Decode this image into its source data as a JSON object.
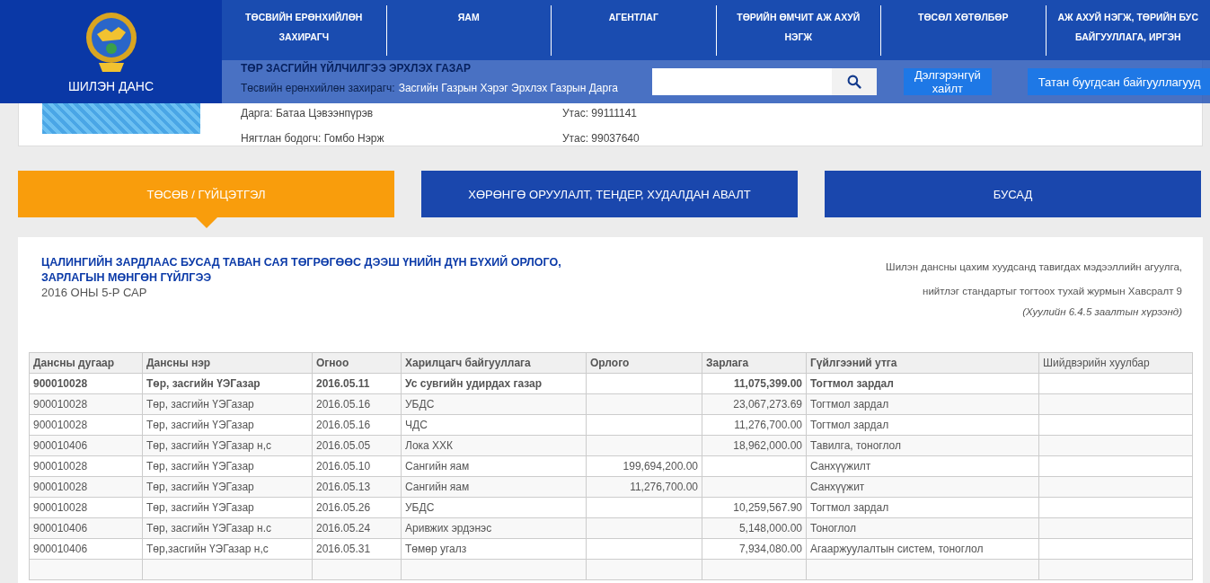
{
  "header": {
    "logo_text": "ШИЛЭН ДАНС",
    "nav": [
      {
        "label": "ТӨСВИЙН ЕРӨНХИЙЛӨН ЗАХИРАГЧ"
      },
      {
        "label": "ЯАМ"
      },
      {
        "label": "АГЕНТЛАГ"
      },
      {
        "label": "ТӨРИЙН ӨМЧИТ АЖ АХУЙ НЭГЖ"
      },
      {
        "label": "ТӨСӨЛ ХӨТӨЛБӨР"
      },
      {
        "label": "АЖ АХУЙ НЭГЖ, ТӨРИЙН БУС БАЙГУУЛЛАГА, ИРГЭН"
      }
    ],
    "buttons": [
      "Дэлгэрэнгүй хайлт",
      "Татан буугдсан байгууллагууд"
    ]
  },
  "org": {
    "title": "ТӨР ЗАСГИЙН ҮЙЛЧИЛГЭЭ ЭРХЛЭХ ГАЗАР",
    "manager_label": "Төсвийн ерөнхийлөн захирагч:",
    "manager_link": "Засгийн Газрын Хэрэг Эрхлэх Газрын Дарга",
    "contacts": [
      {
        "person": "Дарга: Батаа Цэвээнпүрэв",
        "phone": "Утас: 99111141"
      },
      {
        "person": "Нягтлан бодогч: Гомбо Нэрж",
        "phone": "Утас: 99037640"
      }
    ]
  },
  "tabs": [
    {
      "label": "ТӨСӨВ / ГҮЙЦЭТГЭЛ",
      "selected": true
    },
    {
      "label": "ХӨРӨНГӨ ОРУУЛАЛТ, ТЕНДЕР, ХУДАЛДАН АВАЛТ",
      "selected": false
    },
    {
      "label": "БУСАД",
      "selected": false
    }
  ],
  "report": {
    "title": "ЦАЛИНГИЙН ЗАРДЛААС БУСАД ТАВАН САЯ ТӨГРӨГӨӨС ДЭЭШ ҮНИЙН ДҮН БҮХИЙ ОРЛОГО, ЗАРЛАГЫН МӨНГӨН ГҮЙЛГЭЭ",
    "period": "2016 ОНЫ 5-Р САР",
    "notes": [
      "Шилэн дансны цахим хуудсанд тавигдах мэдээллийн агуулга,",
      "нийтлэг стандартыг тогтоох тухай журмын Хавсралт 9"
    ],
    "law_note": "(Хуулийн 6.4.5 заалтын хүрээнд)"
  },
  "table": {
    "columns": [
      "Дансны дугаар",
      "Дансны нэр",
      "Огноо",
      "Харилцагч байгууллага",
      "Орлого",
      "Зарлага",
      "Гүйлгээний утга",
      "Шийдвэрийн хуулбар"
    ],
    "rows": [
      {
        "bold": true,
        "cells": [
          "900010028",
          "Төр, засгийн ҮЭГазар",
          "2016.05.11",
          "Ус сувгийн удирдах газар",
          "",
          "11,075,399.00",
          "Тогтмол зардал",
          ""
        ]
      },
      {
        "bold": false,
        "cells": [
          "900010028",
          "Төр, засгийн ҮЭГазар",
          "2016.05.16",
          "УБДС",
          "",
          "23,067,273.69",
          "Тогтмол зардал",
          ""
        ]
      },
      {
        "bold": false,
        "cells": [
          "900010028",
          "Төр, засгийн ҮЭГазар",
          "2016.05.16",
          "ЧДС",
          "",
          "11,276,700.00",
          "Тогтмол зардал",
          ""
        ]
      },
      {
        "bold": false,
        "cells": [
          "900010406",
          "Төр, засгийн ҮЭГазар н,с",
          "2016.05.05",
          "Лока ХХК",
          "",
          "18,962,000.00",
          "Тавилга, тоноглол",
          ""
        ]
      },
      {
        "bold": false,
        "cells": [
          "900010028",
          "Төр, засгийн ҮЭГазар",
          "2016.05.10",
          "Сангийн яам",
          "199,694,200.00",
          "",
          "Санхүүжилт",
          ""
        ]
      },
      {
        "bold": false,
        "cells": [
          "900010028",
          "Төр, засгийн ҮЭГазар",
          "2016.05.13",
          "Сангийн яам",
          "11,276,700.00",
          "",
          "Санхүүжит",
          ""
        ]
      },
      {
        "bold": false,
        "cells": [
          "900010028",
          "Төр, засгийн ҮЭГазар",
          "2016.05.26",
          "УБДС",
          "",
          "10,259,567.90",
          "Тогтмол зардал",
          ""
        ]
      },
      {
        "bold": false,
        "cells": [
          "900010406",
          "Төр, засгийн ҮЭГазар н.с",
          "2016.05.24",
          "Аривжих эрдэнэс",
          "",
          "5,148,000.00",
          "Тоноглол",
          ""
        ]
      },
      {
        "bold": false,
        "cells": [
          "900010406",
          "Төр,засгийн ҮЭГазар н,с",
          "2016.05.31",
          "Төмөр угалз",
          "",
          "7,934,080.00",
          "Агааржуулалтын систем, тоноглол",
          ""
        ]
      },
      {
        "cells": [
          "",
          "",
          "",
          "",
          "",
          "",
          "",
          ""
        ]
      }
    ]
  }
}
